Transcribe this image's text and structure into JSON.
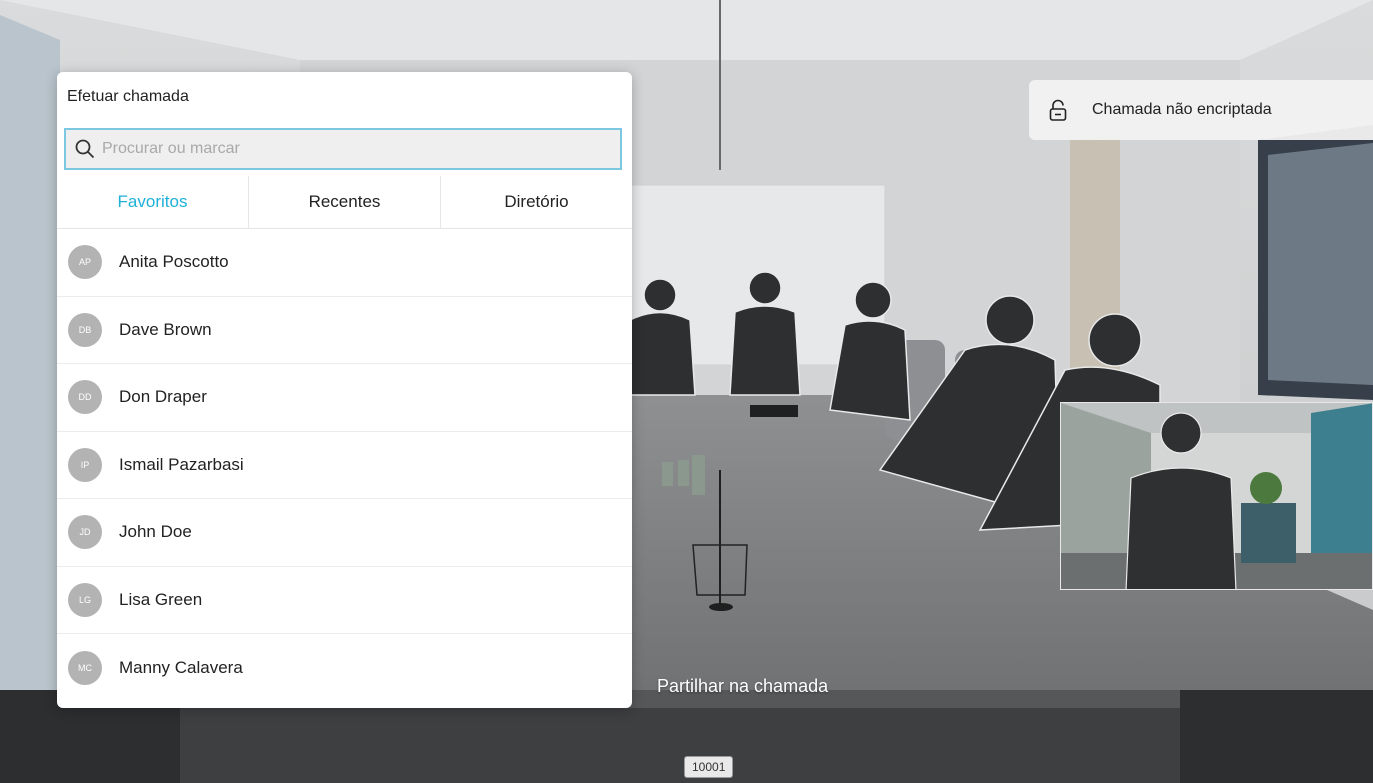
{
  "dial_panel": {
    "title": "Efetuar chamada",
    "search": {
      "placeholder": "Procurar ou marcar",
      "value": ""
    },
    "tabs": [
      {
        "label": "Favoritos",
        "active": true
      },
      {
        "label": "Recentes",
        "active": false
      },
      {
        "label": "Diretório",
        "active": false
      }
    ],
    "contacts": [
      {
        "initials": "AP",
        "name": "Anita Poscotto"
      },
      {
        "initials": "DB",
        "name": "Dave Brown"
      },
      {
        "initials": "DD",
        "name": "Don Draper"
      },
      {
        "initials": "IP",
        "name": "Ismail Pazarbasi"
      },
      {
        "initials": "JD",
        "name": "John Doe"
      },
      {
        "initials": "LG",
        "name": "Lisa Green"
      },
      {
        "initials": "MC",
        "name": "Manny Calavera"
      }
    ]
  },
  "encryption": {
    "icon": "unlocked-icon",
    "label": "Chamada não encriptada"
  },
  "share": {
    "label": "Partilhar na chamada"
  },
  "extension": {
    "number": "10001"
  },
  "colors": {
    "accent": "#1fb0d8",
    "avatar": "#b3b3b3",
    "search_border": "#7cc8e0"
  }
}
